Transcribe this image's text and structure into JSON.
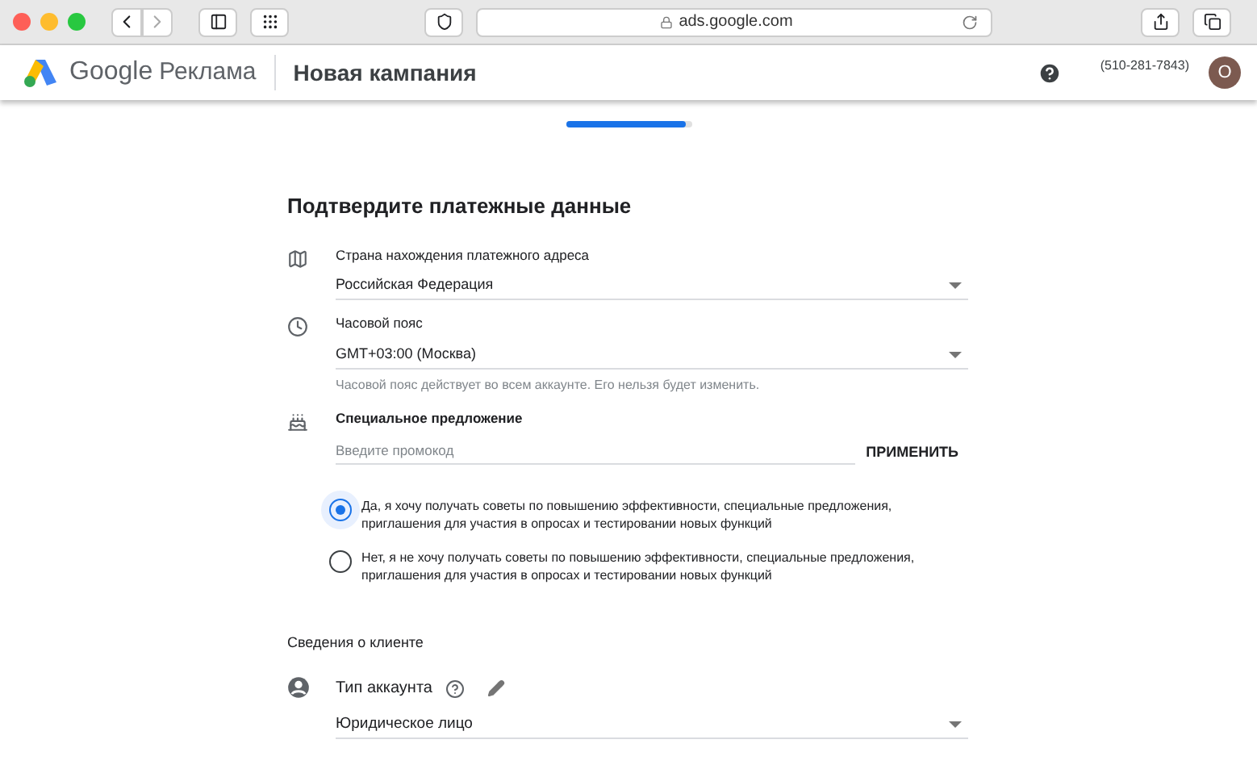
{
  "browser": {
    "url": "ads.google.com"
  },
  "header": {
    "brand_google": "Google",
    "brand_product": "Реклама",
    "page_title": "Новая кампания",
    "phone": "(510-281-7843)",
    "avatar_letter": "O"
  },
  "progress": {
    "level": 0.95
  },
  "section_title": "Подтвердите платежные данные",
  "fields": [
    {
      "kind": "select",
      "label": "Страна нахождения платежного адреса",
      "value": "Российская Федерация"
    },
    {
      "kind": "select",
      "label": "Часовой пояс",
      "value": "GMT+03:00 (Москва)",
      "hint": "Часовой пояс действует во всем аккаунте. Его нельзя будет изменить."
    },
    {
      "kind": "promo",
      "label": "Специальное предложение",
      "placeholder": "Введите промокод",
      "button": "ПРИМЕНИТЬ"
    }
  ],
  "radios": [
    {
      "label": "Да, я хочу получать советы по повышению эффективности, специальные предложения, приглашения для участия в опросах и тестировании новых функций",
      "selected": true
    },
    {
      "label": "Нет, я не хочу получать советы по повышению эффективности, специальные предложения, приглашения для участия в опросах и тестировании новых функций",
      "selected": false
    }
  ],
  "client_section": {
    "title": "Сведения о клиенте",
    "account_type_label": "Тип аккаунта",
    "account_type_value": "Юридическое лицо"
  }
}
